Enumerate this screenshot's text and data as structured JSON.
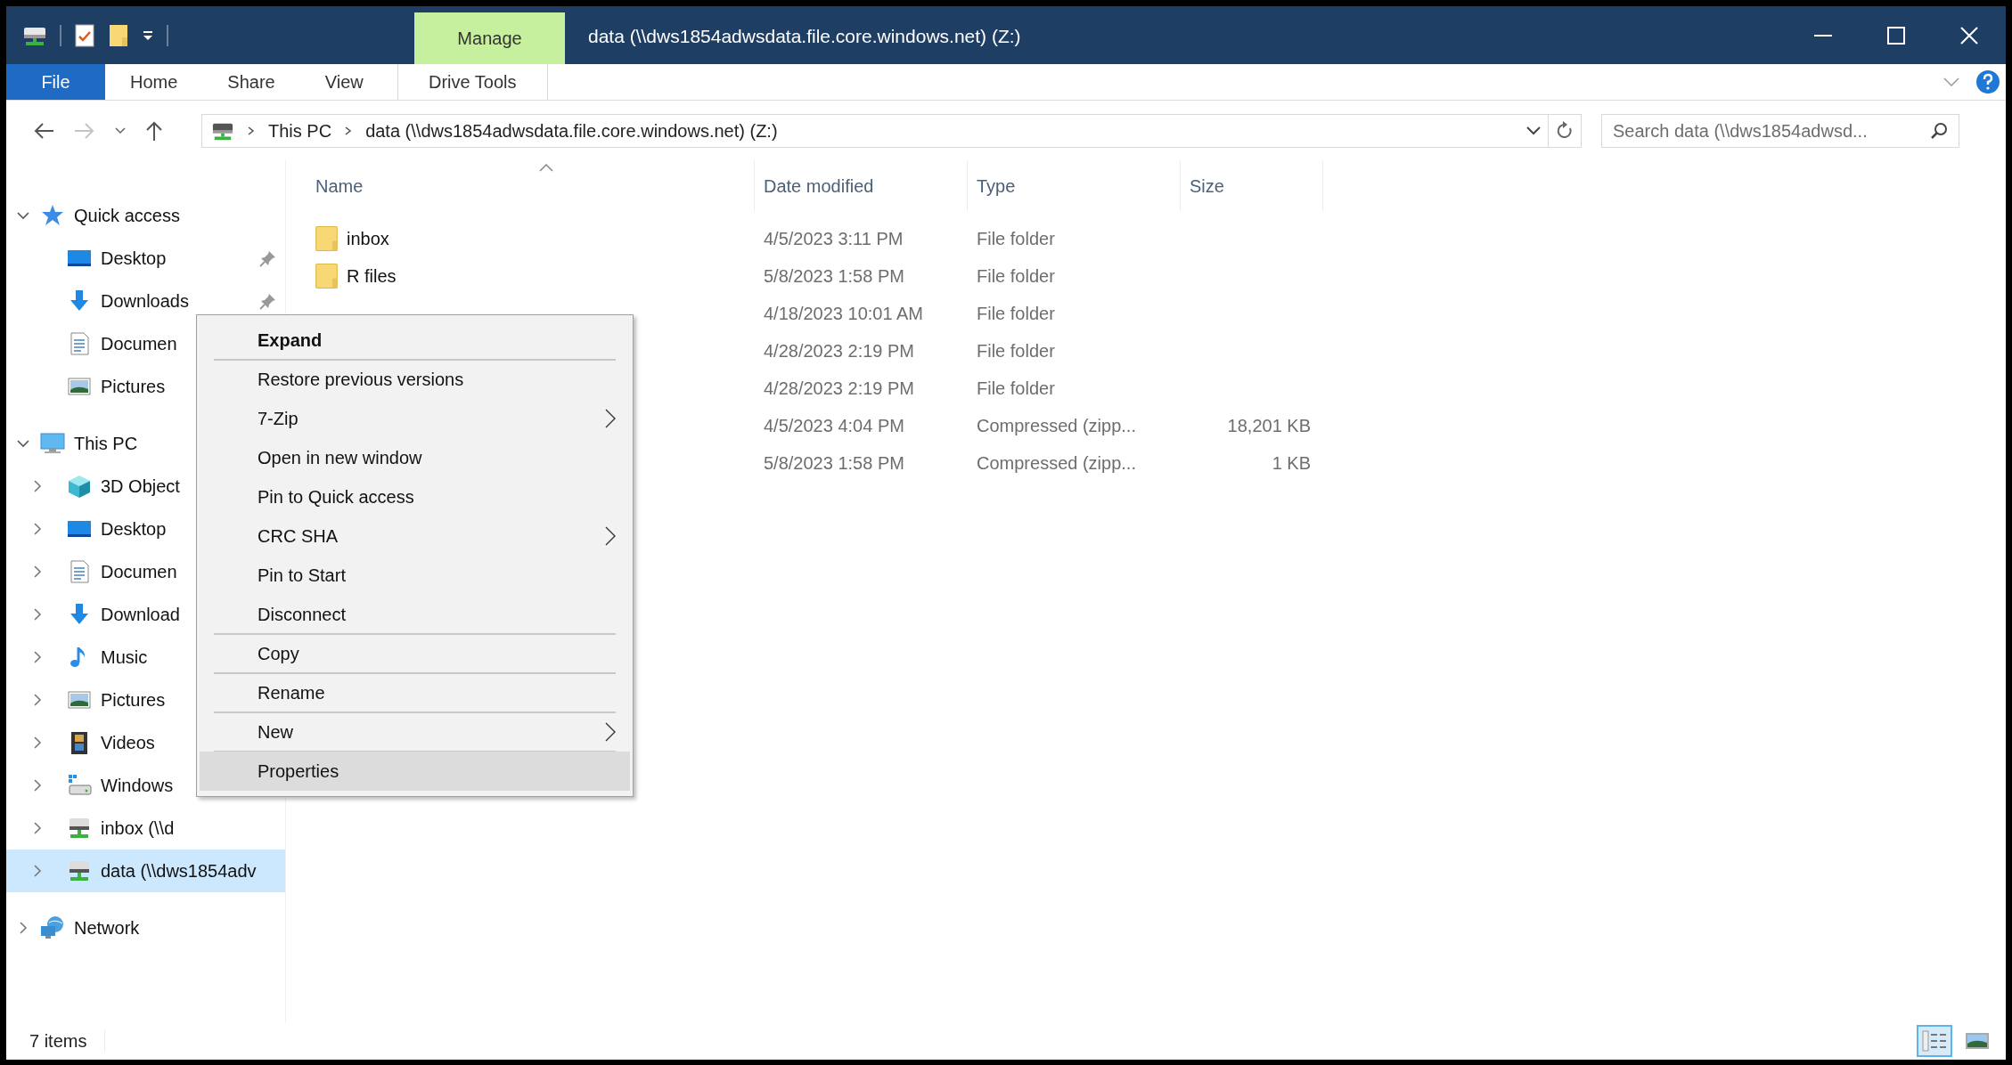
{
  "window": {
    "title": "data (\\\\dws1854adwsdata.file.core.windows.net) (Z:)",
    "context_group": "Manage"
  },
  "ribbon_tabs": [
    {
      "label": "File",
      "kind": "file",
      "selected": false
    },
    {
      "label": "Home",
      "kind": "tab",
      "selected": false
    },
    {
      "label": "Share",
      "kind": "tab",
      "selected": false
    },
    {
      "label": "View",
      "kind": "tab",
      "selected": false
    },
    {
      "label": "Drive Tools",
      "kind": "context",
      "selected": false
    }
  ],
  "address_bar": {
    "path": [
      "This PC",
      "data (\\\\dws1854adwsdata.file.core.windows.net) (Z:)"
    ]
  },
  "search": {
    "placeholder": "Search data (\\\\dws1854adwsd..."
  },
  "navigation_pane": [
    {
      "label": "Quick access",
      "kind": "star",
      "expanded": true,
      "selected": false,
      "children": [
        {
          "label": "Desktop",
          "kind": "desktop",
          "pinned": true,
          "selected": false
        },
        {
          "label": "Downloads",
          "kind": "download",
          "pinned": true,
          "selected": false
        },
        {
          "label": "Documen",
          "kind": "document",
          "pinned": false,
          "selected": false
        },
        {
          "label": "Pictures",
          "kind": "pictures",
          "pinned": false,
          "selected": false
        }
      ]
    },
    {
      "label": "This PC",
      "kind": "pc",
      "expanded": true,
      "selected": false,
      "children": [
        {
          "label": "3D Object",
          "kind": "cube",
          "expanded": false,
          "selected": false
        },
        {
          "label": "Desktop",
          "kind": "desktop",
          "expanded": false,
          "selected": false
        },
        {
          "label": "Documen",
          "kind": "document",
          "expanded": false,
          "selected": false
        },
        {
          "label": "Download",
          "kind": "download",
          "expanded": false,
          "selected": false
        },
        {
          "label": "Music",
          "kind": "music",
          "expanded": false,
          "selected": false
        },
        {
          "label": "Pictures",
          "kind": "pictures",
          "expanded": false,
          "selected": false
        },
        {
          "label": "Videos",
          "kind": "videos",
          "expanded": false,
          "selected": false
        },
        {
          "label": "Windows",
          "kind": "windrive",
          "expanded": false,
          "selected": false
        },
        {
          "label": "inbox (\\\\d",
          "kind": "netdrive",
          "expanded": false,
          "selected": false
        },
        {
          "label": "data (\\\\dws1854adv",
          "kind": "netdrive",
          "expanded": false,
          "selected": true
        }
      ]
    },
    {
      "label": "Network",
      "kind": "network",
      "expanded": false,
      "selected": false
    }
  ],
  "file_list": {
    "columns": [
      {
        "label": "Name",
        "sorted": true
      },
      {
        "label": "Date modified",
        "sorted": false
      },
      {
        "label": "Type",
        "sorted": false
      },
      {
        "label": "Size",
        "sorted": false
      }
    ],
    "rows": [
      {
        "name": "inbox",
        "kind": "folder",
        "date": "4/5/2023 3:11 PM",
        "type": "File folder"
      },
      {
        "name": "R files",
        "kind": "folder",
        "date": "5/8/2023 1:58 PM",
        "type": "File folder"
      },
      {
        "date": "4/18/2023 10:01 AM",
        "type": "File folder"
      },
      {
        "date": "4/28/2023 2:19 PM",
        "type": "File folder"
      },
      {
        "date": "4/28/2023 2:19 PM",
        "type": "File folder"
      },
      {
        "date": "4/5/2023 4:04 PM",
        "type": "Compressed (zipp...",
        "size": "18,201 KB"
      },
      {
        "date": "5/8/2023 1:58 PM",
        "type": "Compressed (zipp...",
        "size": "1 KB"
      }
    ]
  },
  "context_menu": [
    {
      "label": "Expand",
      "default": true,
      "submenu": false,
      "separator_after": true,
      "selected": false
    },
    {
      "label": "Restore previous versions",
      "default": false,
      "submenu": false,
      "separator_after": false,
      "selected": false
    },
    {
      "label": "7-Zip",
      "default": false,
      "submenu": true,
      "separator_after": false,
      "selected": false
    },
    {
      "label": "Open in new window",
      "default": false,
      "submenu": false,
      "separator_after": false,
      "selected": false
    },
    {
      "label": "Pin to Quick access",
      "default": false,
      "submenu": false,
      "separator_after": false,
      "selected": false
    },
    {
      "label": "CRC SHA",
      "default": false,
      "submenu": true,
      "separator_after": false,
      "selected": false
    },
    {
      "label": "Pin to Start",
      "default": false,
      "submenu": false,
      "separator_after": false,
      "selected": false
    },
    {
      "label": "Disconnect",
      "default": false,
      "submenu": false,
      "separator_after": true,
      "selected": false
    },
    {
      "label": "Copy",
      "default": false,
      "submenu": false,
      "separator_after": true,
      "selected": false
    },
    {
      "label": "Rename",
      "default": false,
      "submenu": false,
      "separator_after": true,
      "selected": false
    },
    {
      "label": "New",
      "default": false,
      "submenu": true,
      "separator_after": true,
      "selected": false
    },
    {
      "label": "Properties",
      "default": false,
      "submenu": false,
      "separator_after": false,
      "selected": true
    }
  ],
  "status_bar": {
    "item_count": "7 items",
    "views": [
      {
        "kind": "details",
        "selected": true
      },
      {
        "kind": "large_icons",
        "selected": false
      }
    ]
  }
}
